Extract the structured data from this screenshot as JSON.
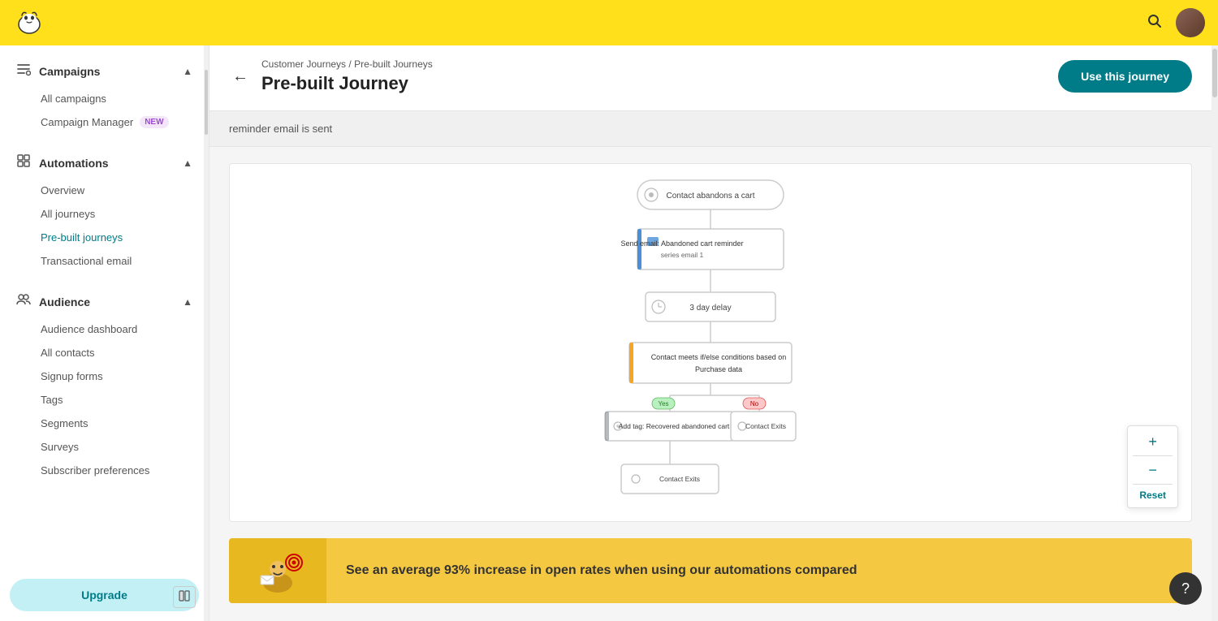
{
  "topbar": {
    "logo_alt": "Mailchimp"
  },
  "sidebar": {
    "campaigns_label": "Campaigns",
    "all_campaigns_label": "All campaigns",
    "campaign_manager_label": "Campaign Manager",
    "campaign_manager_badge": "New",
    "automations_label": "Automations",
    "overview_label": "Overview",
    "all_journeys_label": "All journeys",
    "prebuilt_journeys_label": "Pre-built journeys",
    "transactional_email_label": "Transactional email",
    "audience_label": "Audience",
    "audience_dashboard_label": "Audience dashboard",
    "all_contacts_label": "All contacts",
    "signup_forms_label": "Signup forms",
    "tags_label": "Tags",
    "segments_label": "Segments",
    "surveys_label": "Surveys",
    "subscriber_preferences_label": "Subscriber preferences",
    "upgrade_label": "Upgrade"
  },
  "breadcrumb": {
    "part1": "Customer Journeys",
    "separator": " / ",
    "part2": "Pre-built Journeys"
  },
  "page": {
    "title": "Pre-built Journey",
    "use_journey_btn": "Use this journey",
    "description": "reminder email is sent"
  },
  "diagram": {
    "node1": "Contact abandons a cart",
    "node2_label": "Send email: Abandoned cart reminder",
    "node2_sub": "series email 1",
    "node3": "3 day delay",
    "node4": "Contact meets if/else conditions based on",
    "node4_sub": "Purchase data",
    "branch_yes": "Yes",
    "branch_no": "No",
    "node5": "Add tag: Recovered abandoned cart",
    "node6_right": "Contact Exits",
    "node7": "Contact Exits"
  },
  "zoom": {
    "plus": "+",
    "minus": "−",
    "reset": "Reset"
  },
  "promo": {
    "text": "See an average 93% increase in open rates when using our automations compared",
    "icon": "📧🎯"
  },
  "help": {
    "label": "?"
  }
}
